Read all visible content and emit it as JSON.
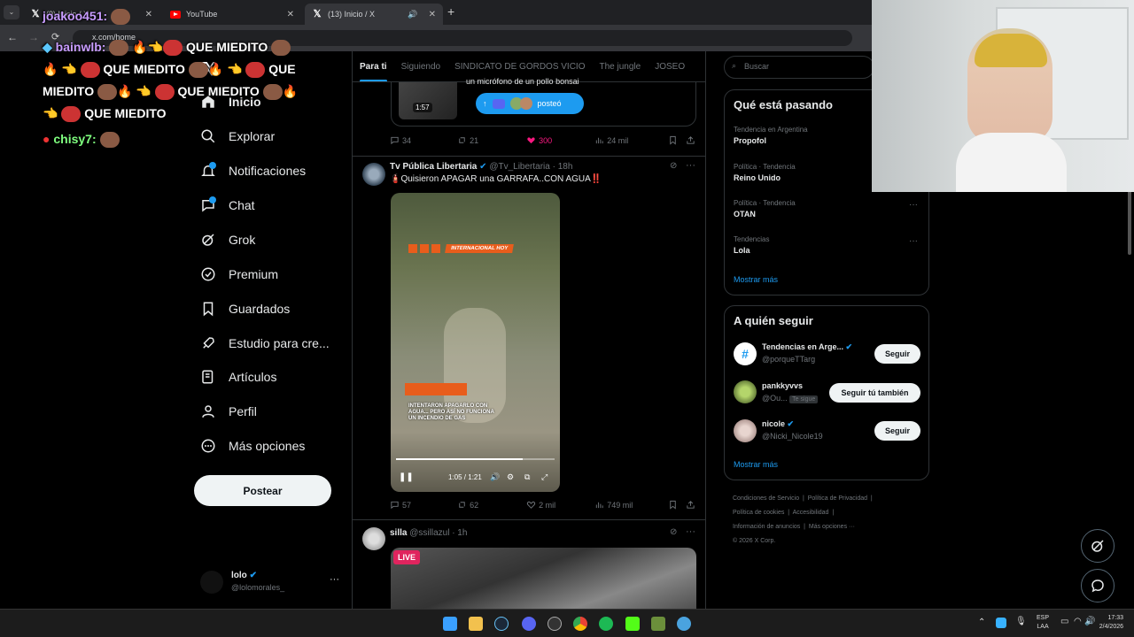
{
  "browser": {
    "tabs": [
      {
        "label": "(9) Inicio / X",
        "icon": "x-logo"
      },
      {
        "label": "YouTube",
        "icon": "youtube-logo"
      },
      {
        "label": "(13) Inicio / X",
        "icon": "x-logo"
      }
    ],
    "url": "x.com/home"
  },
  "chat_overlay": {
    "lines": [
      {
        "user": "joakoo451:",
        "text": ""
      },
      {
        "user": "bainwlb:",
        "text": "QUE MIEDITO"
      },
      {
        "text1": "QUE MIEDITO",
        "text2": "QUE"
      },
      {
        "text1": "MIEDITO",
        "text2": "QUE MIEDITO"
      },
      {
        "text": "QUE MIEDITO"
      },
      {
        "user": "chisy7:"
      }
    ],
    "user_color": "#c89cff",
    "user2_color": "#7fff7f"
  },
  "nav": {
    "items": [
      {
        "label": "Inicio",
        "icon": "home-icon"
      },
      {
        "label": "Explorar",
        "icon": "search-icon"
      },
      {
        "label": "Notificaciones",
        "icon": "bell-icon"
      },
      {
        "label": "Chat",
        "icon": "chat-icon"
      },
      {
        "label": "Grok",
        "icon": "grok-icon"
      },
      {
        "label": "Premium",
        "icon": "premium-icon"
      },
      {
        "label": "Guardados",
        "icon": "bookmark-icon"
      },
      {
        "label": "Estudio para cre...",
        "icon": "rocket-icon"
      },
      {
        "label": "Artículos",
        "icon": "article-icon"
      },
      {
        "label": "Perfil",
        "icon": "profile-icon"
      },
      {
        "label": "Más opciones",
        "icon": "more-icon"
      }
    ],
    "post_button": "Postear",
    "account": {
      "name": "lolo",
      "handle": "@lolomorales_"
    }
  },
  "timeline": {
    "tabs": [
      "Para ti",
      "Siguiendo",
      "SINDICATO DE GORDOS VICIO",
      "The jungle",
      "JOSEO"
    ],
    "post0": {
      "snippet": "un micrófono de un pollo bonsai",
      "video_time": "1:57",
      "posted_label": "posteó",
      "replies": "34",
      "reposts": "21",
      "likes": "300",
      "views": "24 mil"
    },
    "post1": {
      "author": "Tv Pública Libertaria",
      "handle": "@Tv_Libertaria",
      "time": "· 18h",
      "text": "🧯Quisieron APAGAR una GARRAFA..CON AGUA‼️",
      "video_banner": "INTERNACIONAL HOY",
      "video_caption": "INTENTARON APAGARLO CON AGUA... PERO ASÍ NO FUNCIONA UN INCENDIO DE GAS",
      "video_time": "1:05 / 1:21",
      "progress": 0.8,
      "replies": "57",
      "reposts": "62",
      "likes": "2 mil",
      "views": "749 mil"
    },
    "post2": {
      "author": "silla",
      "handle": "@ssillazul",
      "time": "· 1h",
      "live_label": "LIVE"
    }
  },
  "sidebar": {
    "search_placeholder": "Buscar",
    "trends_title": "Qué está pasando",
    "trends": [
      {
        "meta": "Tendencia en Argentina",
        "name": "Propofol"
      },
      {
        "meta": "Política · Tendencia",
        "name": "Reino Unido"
      },
      {
        "meta": "Política · Tendencia",
        "name": "OTAN"
      },
      {
        "meta": "Tendencias",
        "name": "Lola"
      }
    ],
    "show_more": "Mostrar más",
    "follow_title": "A quién seguir",
    "follow": [
      {
        "name": "Tendencias en Arge...",
        "handle": "@porqueTTarg",
        "button": "Seguir"
      },
      {
        "name": "pankkyvvs",
        "handle": "@Ou...",
        "badge": "Te sigue",
        "button": "Seguir tú también"
      },
      {
        "name": "nicole",
        "handle": "@Nicki_Nicole19",
        "button": "Seguir"
      }
    ],
    "footer_links": [
      "Condiciones de Servicio",
      "Política de Privacidad",
      "Política de cookies",
      "Accesibilidad",
      "Información de anuncios",
      "Más opciones ···"
    ],
    "copyright": "© 2026 X Corp."
  },
  "taskbar": {
    "lang": "ESP",
    "layout": "LAA",
    "time": "17:33",
    "date": "2/4/2026"
  },
  "colors": {
    "accent": "#1d9bf0",
    "like": "#f91880",
    "discord": "#5865f2"
  }
}
